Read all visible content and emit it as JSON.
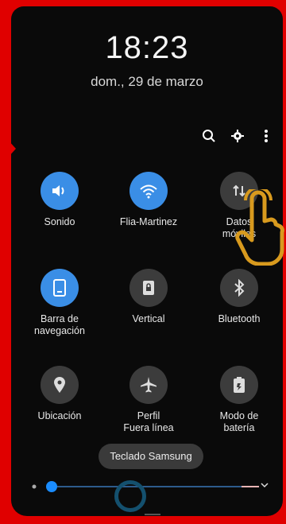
{
  "clock": {
    "time": "18:23",
    "date": "dom., 29 de marzo"
  },
  "toolbar": {
    "icons": [
      "search-icon",
      "gear-icon",
      "more-vert-icon"
    ]
  },
  "tiles": [
    {
      "label": "Sonido",
      "state": "on",
      "icon": "volume-icon"
    },
    {
      "label": "Flia-Martinez",
      "state": "on",
      "icon": "wifi-icon"
    },
    {
      "label": "Datos\nmóviles",
      "state": "off",
      "icon": "data-arrows-icon"
    },
    {
      "label": "Barra de\nnavegación",
      "state": "on",
      "icon": "nav-bar-icon"
    },
    {
      "label": "Vertical",
      "state": "off",
      "icon": "lock-rotation-icon"
    },
    {
      "label": "Bluetooth",
      "state": "off",
      "icon": "bluetooth-icon"
    },
    {
      "label": "Ubicación",
      "state": "off",
      "icon": "location-pin-icon"
    },
    {
      "label": "Perfil\nFuera línea",
      "state": "off",
      "icon": "airplane-icon"
    },
    {
      "label": "Modo de\nbatería",
      "state": "off",
      "icon": "battery-mode-icon"
    }
  ],
  "keyboard_toast": "Teclado Samsung",
  "brightness": {
    "level": 0.03
  },
  "colors": {
    "accent": "#3a8ee6",
    "off": "#3c3c3c",
    "frame": "#e00000"
  }
}
